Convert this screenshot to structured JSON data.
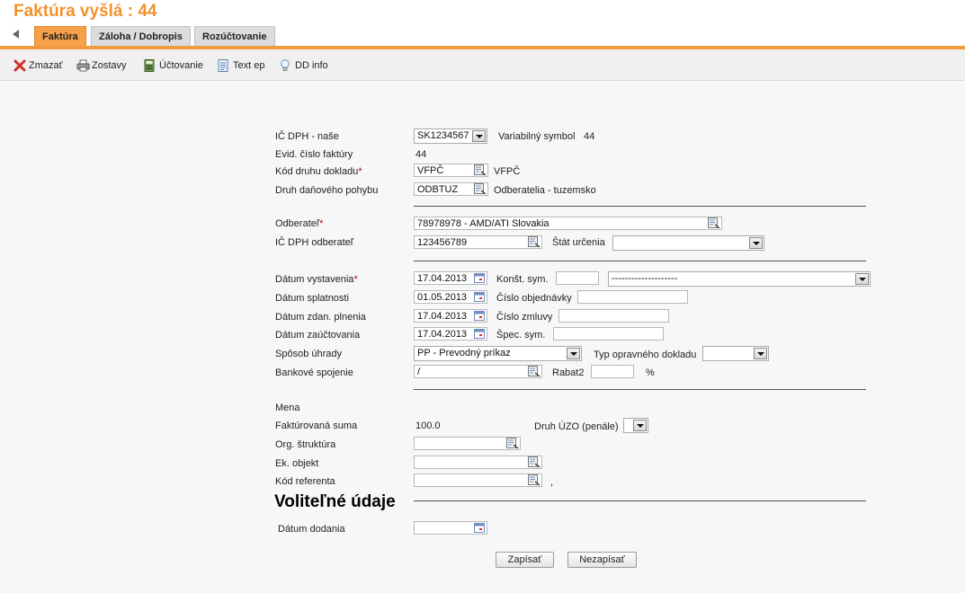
{
  "header": {
    "title": "Faktúra vyšlá :  44",
    "tabs": [
      "Faktúra",
      "Záloha / Dobropis",
      "Rozúčtovanie"
    ]
  },
  "toolbar": {
    "delete": "Zmazať",
    "reports": "Zostavy",
    "accounting": "Účtovanie",
    "text": "Text ep",
    "info": "DD info"
  },
  "form": {
    "ic_dph_nase_label": "IČ DPH - naše",
    "ic_dph_nase_value": "SK1234567",
    "variabilny_symbol_label": "Variabilný symbol",
    "variabilny_symbol_value": "44",
    "evid_cislo_label": "Evid. číslo faktúry",
    "evid_cislo_value": "44",
    "kod_druhu_label": "Kód druhu dokladu",
    "kod_druhu_value": "VFPČ",
    "kod_druhu_desc": "VFPČ",
    "druh_dan_label": "Druh daňového pohybu",
    "druh_dan_value": "ODBTUZ",
    "druh_dan_desc": "Odberatelia - tuzemsko",
    "odberatel_label": "Odberateľ",
    "odberatel_value": "78978978 - AMD/ATI Slovakia",
    "ic_dph_odb_label": "IČ DPH odberateľ",
    "ic_dph_odb_value": "123456789",
    "stat_urcenia_label": "Štát určenia",
    "stat_urcenia_value": "",
    "datum_vyst_label": "Dátum vystavenia",
    "datum_vyst_value": "17.04.2013",
    "konst_sym_label": "Konšt. sym.",
    "konst_sym_value": "",
    "konst_sym_select": "--------------------",
    "datum_splat_label": "Dátum splatnosti",
    "datum_splat_value": "01.05.2013",
    "cislo_obj_label": "Číslo objednávky",
    "datum_zdan_label": "Dátum zdan. plnenia",
    "datum_zdan_value": "17.04.2013",
    "cislo_zml_label": "Číslo zmluvy",
    "datum_zauct_label": "Dátum zaúčtovania",
    "datum_zauct_value": "17.04.2013",
    "spec_sym_label": "Špec. sym.",
    "sposob_uhr_label": "Spôsob úhrady",
    "sposob_uhr_value": "PP - Prevodný príkaz",
    "typ_oprav_label": "Typ opravného dokladu",
    "bank_label": "Bankové spojenie",
    "bank_value": "/",
    "rabat_label": "Rabat2",
    "rabat_unit": "%",
    "mena_label": "Mena",
    "fakt_suma_label": "Faktúrovaná suma",
    "fakt_suma_value": "100.0",
    "druh_uzo_label": "Druh ÚZO (penále)",
    "org_label": "Org. štruktúra",
    "ek_label": "Ek. objekt",
    "kod_ref_label": "Kód referenta",
    "kod_ref_suffix": ",",
    "optional_heading": "Voliteľné údaje",
    "datum_dod_label": "Dátum dodania"
  },
  "buttons": {
    "save": "Zapísať",
    "cancel": "Nezapísať"
  },
  "colors": {
    "accent": "#f39a3e",
    "title": "#f0922e",
    "required": "#cc0000"
  },
  "icons": [
    "back-arrow-icon",
    "delete-icon",
    "printer-icon",
    "calculator-icon",
    "document-icon",
    "bulb-icon",
    "lookup-icon",
    "calendar-icon",
    "dropdown-icon"
  ]
}
